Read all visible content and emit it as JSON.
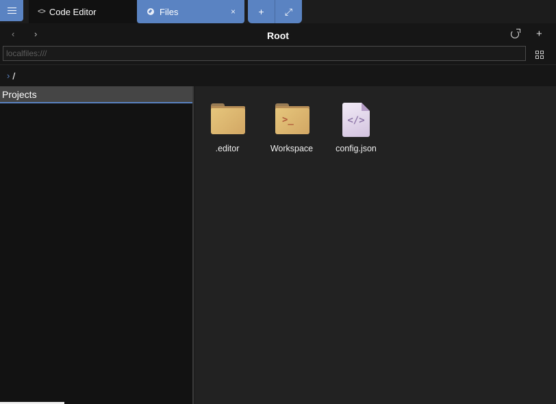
{
  "topbar": {
    "tabs": [
      {
        "label": "Code Editor",
        "icon": "code-icon"
      },
      {
        "label": "Files",
        "icon": "compass-icon",
        "close_glyph": "×"
      }
    ],
    "add_glyph": "+",
    "expand_glyph": "⤢",
    "accent_color": "#5a83c2"
  },
  "nav": {
    "back_glyph": "‹",
    "forward_glyph": "›",
    "title": "Root",
    "add_glyph": "+",
    "path_placeholder": "localfiles:///"
  },
  "breadcrumb": {
    "chevron": "›",
    "path": "/"
  },
  "sidebar": {
    "header": "Projects"
  },
  "files": [
    {
      "name": ".editor",
      "type": "folder",
      "icon": "folder-icon"
    },
    {
      "name": "Workspace",
      "type": "folder",
      "icon": "terminal-folder-icon",
      "symbol": ">_"
    },
    {
      "name": "config.json",
      "type": "file",
      "icon": "code-file-icon",
      "symbol": "</>"
    }
  ]
}
